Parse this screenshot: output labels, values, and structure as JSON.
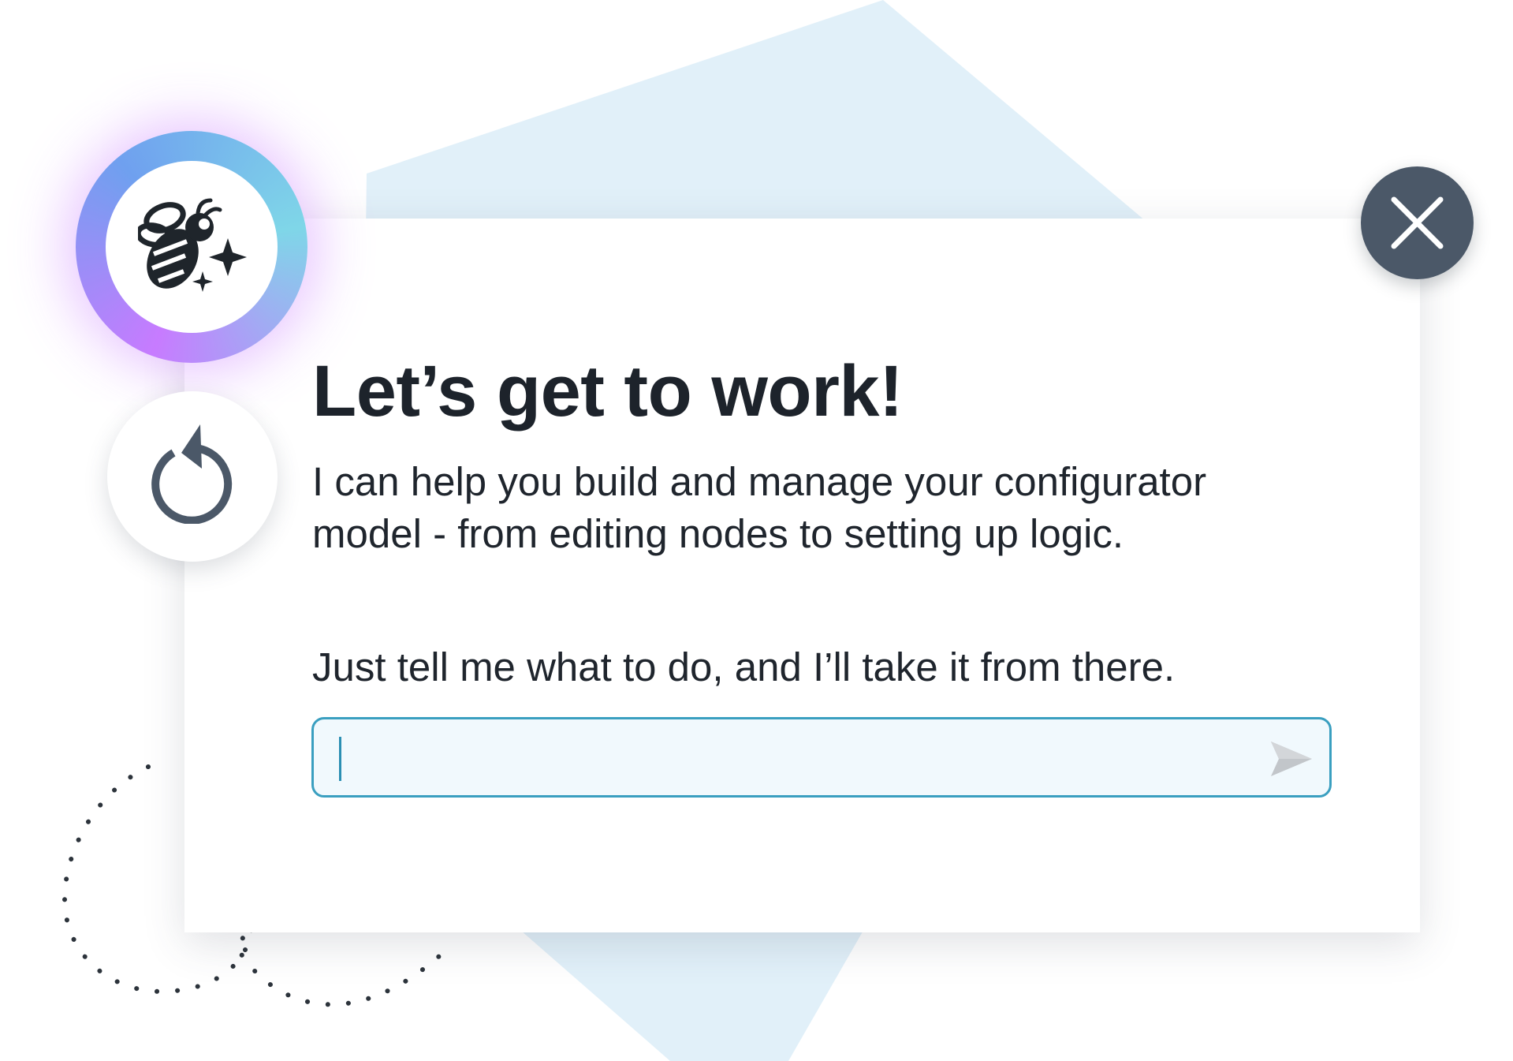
{
  "dialog": {
    "title": "Let’s get to work!",
    "description": "I can help you build and manage your configurator model - from editing nodes to setting up logic.",
    "instruction": "Just tell me what to do, and I’ll take it from there."
  },
  "chat_input": {
    "value": "",
    "placeholder": ""
  },
  "icons": {
    "avatar": "bee-sparkle-icon",
    "refresh": "refresh-icon",
    "close": "close-icon",
    "send": "send-icon"
  },
  "colors": {
    "accent": "#3a9fc0",
    "input_background": "#f1f9fd",
    "close_background": "#4b5868",
    "text": "#1f252d",
    "background_shape": "#e1f0f9",
    "avatar_gradient": [
      "#c77bff",
      "#6fa0ef",
      "#7fd6e8"
    ]
  }
}
